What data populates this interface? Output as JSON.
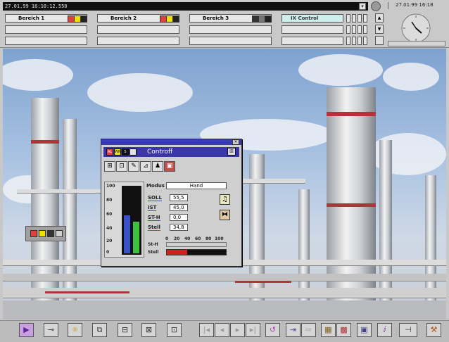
{
  "header": {
    "datetime": "27.01.99   16:10:12.550",
    "clock_text": "27.01.99  16:18",
    "areas": [
      {
        "label": "Bereich 1",
        "states": [
          "AL",
          "W",
          "S"
        ]
      },
      {
        "label": "Bereich 2",
        "states": [
          "AL",
          "W",
          "S"
        ]
      },
      {
        "label": "Bereich 3",
        "states": [
          "",
          "",
          ""
        ]
      }
    ],
    "ix_control": "IX Control",
    "scroll_up": "▲",
    "scroll_down": "▼"
  },
  "dialog": {
    "title": "Controff",
    "badges": [
      "AL",
      "WN",
      "S"
    ],
    "tabs": [
      "⊞",
      "⊡",
      "✎",
      "⊿",
      "♟",
      "▣"
    ],
    "modus_label": "Modus",
    "modus_value": "Hand",
    "soll_label": "SOLL",
    "soll_value": "55,5",
    "ist_label": "IST",
    "ist_value": "45,0",
    "sth_label": "ST-H",
    "sth_value": "0,0",
    "stell_label": "Stell",
    "stell_value": "34,8",
    "gauge_ticks": [
      "100",
      "80",
      "60",
      "40",
      "20",
      "0"
    ],
    "scale_ticks": [
      "0",
      "20",
      "40",
      "60",
      "80",
      "100"
    ],
    "grad_label": "St-H",
    "stell_bar_label": "Stell",
    "stell_level": 0.348
  },
  "toolbar": {
    "icons": [
      "▶",
      "⊸",
      "☼",
      "⧉",
      "⊟",
      "⊠",
      "⊡",
      "|◂",
      "◂",
      "▸",
      "▸|",
      "↺",
      "⇥",
      "⇨",
      "▦",
      "▩",
      "▣",
      "ⅈ",
      "⊣",
      "⚒"
    ]
  }
}
